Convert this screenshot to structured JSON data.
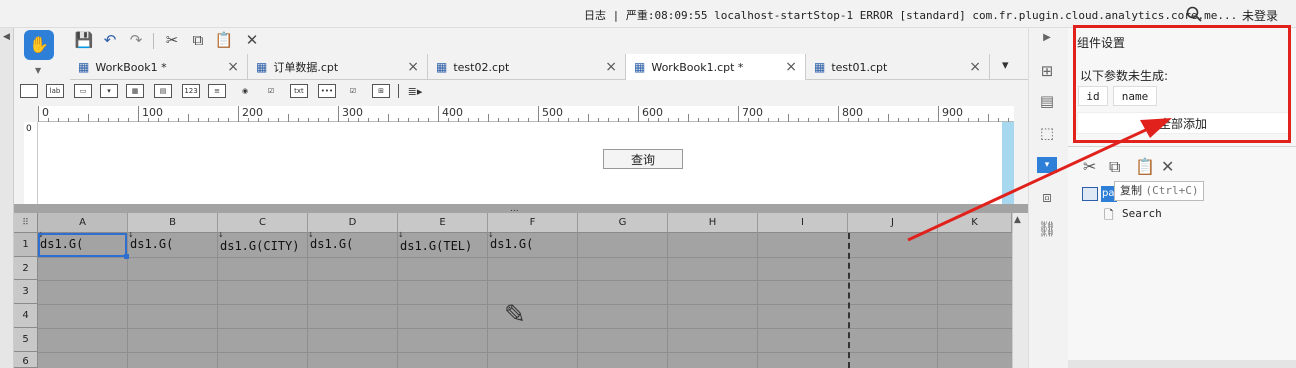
{
  "topbar": {
    "log_text": "日志 | 严重:08:09:55 localhost-startStop-1 ERROR [standard] com.fr.plugin.cloud.analytics.core.me...",
    "login": "未登录"
  },
  "tabs": [
    {
      "label": "WorkBook1 *"
    },
    {
      "label": "订单数据.cpt"
    },
    {
      "label": "test02.cpt"
    },
    {
      "label": "WorkBook1.cpt *"
    },
    {
      "label": "test01.cpt"
    }
  ],
  "ruler": [
    "0",
    "100",
    "200",
    "300",
    "400",
    "500",
    "600",
    "700",
    "800",
    "900"
  ],
  "vruler": "0",
  "canvas": {
    "query_button": "查询"
  },
  "sheet": {
    "columns": [
      "A",
      "B",
      "C",
      "D",
      "E",
      "F",
      "G",
      "H",
      "I",
      "J",
      "K"
    ],
    "rows": [
      "1",
      "2",
      "3",
      "4",
      "5",
      "6"
    ],
    "row1": [
      "ds1.G(",
      "ds1.G(",
      "ds1.G(CITY)",
      "ds1.G(",
      "ds1.G(TEL)",
      "ds1.G("
    ],
    "dots": "..."
  },
  "panel": {
    "title": "组件设置",
    "subtitle": "以下参数未生成:",
    "params": [
      "id",
      "name"
    ],
    "add_all": "全部添加",
    "tooltip_label": "复制",
    "tooltip_hotkey": "(Ctrl+C)",
    "tree_root": "pa",
    "tree_child": "Search"
  },
  "annotation": {
    "color": "#e0211c"
  }
}
